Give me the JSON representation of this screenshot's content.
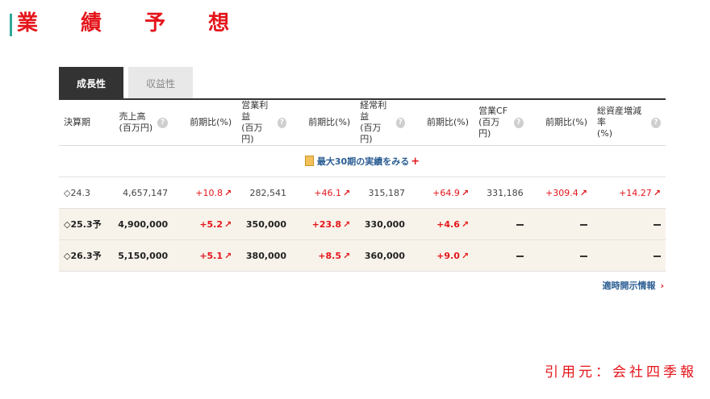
{
  "title": "業 績 予 想",
  "tabs": [
    "成長性",
    "収益性"
  ],
  "columns": [
    {
      "l1": "決算期",
      "l2": "",
      "help": false
    },
    {
      "l1": "売上高",
      "l2": "(百万円)",
      "help": true
    },
    {
      "l1": "前期比(%)",
      "l2": "",
      "help": false
    },
    {
      "l1": "営業利益",
      "l2": "(百万円)",
      "help": true
    },
    {
      "l1": "前期比(%)",
      "l2": "",
      "help": false
    },
    {
      "l1": "経常利益",
      "l2": "(百万円)",
      "help": true
    },
    {
      "l1": "前期比(%)",
      "l2": "",
      "help": false
    },
    {
      "l1": "営業CF",
      "l2": "(百万円)",
      "help": true
    },
    {
      "l1": "前期比(%)",
      "l2": "",
      "help": false
    },
    {
      "l1": "総資産増減率",
      "l2": "(%)",
      "help": true
    }
  ],
  "more_link": "最大30期の実績をみる",
  "rows": [
    {
      "forecast": false,
      "cells": [
        "◇24.3",
        "4,657,147",
        "+10.8",
        "282,541",
        "+46.1",
        "315,187",
        "+64.9",
        "331,186",
        "+309.4",
        "+14.27"
      ]
    },
    {
      "forecast": true,
      "cells": [
        "◇25.3予",
        "4,900,000",
        "+5.2",
        "350,000",
        "+23.8",
        "330,000",
        "+4.6",
        "—",
        "—",
        "—"
      ]
    },
    {
      "forecast": true,
      "cells": [
        "◇26.3予",
        "5,150,000",
        "+5.1",
        "380,000",
        "+8.5",
        "360,000",
        "+9.0",
        "—",
        "—",
        "—"
      ]
    }
  ],
  "disclosure_link": "適時開示情報",
  "source": "引用元：会社四季報"
}
